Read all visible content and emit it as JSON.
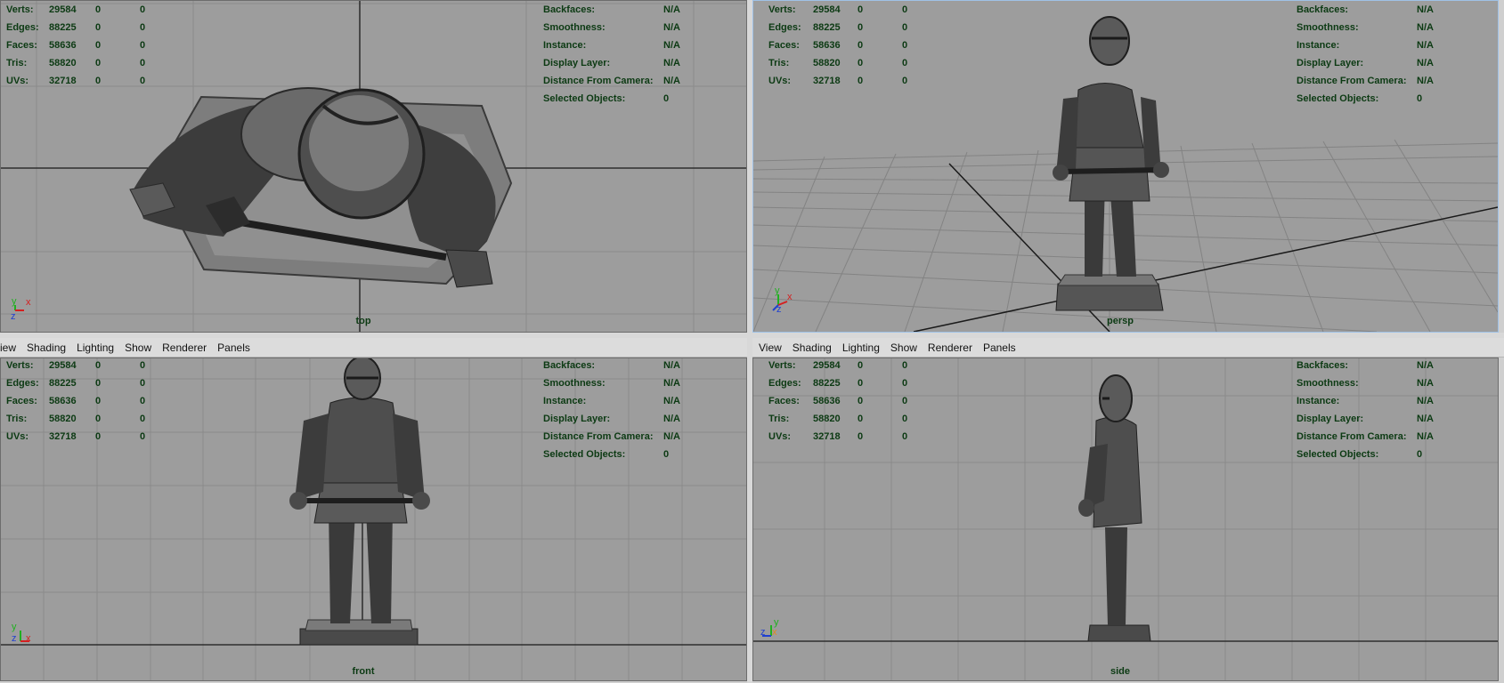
{
  "menu": [
    "View",
    "Shading",
    "Lighting",
    "Show",
    "Renderer",
    "Panels"
  ],
  "menu_left_first": "iew",
  "hud_left": [
    {
      "label": "Verts:",
      "a": "29584",
      "b": "0",
      "c": "0"
    },
    {
      "label": "Edges:",
      "a": "88225",
      "b": "0",
      "c": "0"
    },
    {
      "label": "Faces:",
      "a": "58636",
      "b": "0",
      "c": "0"
    },
    {
      "label": "Tris:",
      "a": "58820",
      "b": "0",
      "c": "0"
    },
    {
      "label": "UVs:",
      "a": "32718",
      "b": "0",
      "c": "0"
    }
  ],
  "hud_right": [
    {
      "label": "Backfaces:",
      "value": "N/A"
    },
    {
      "label": "Smoothness:",
      "value": "N/A"
    },
    {
      "label": "Instance:",
      "value": "N/A"
    },
    {
      "label": "Display Layer:",
      "value": "N/A"
    },
    {
      "label": "Distance From Camera:",
      "value": "N/A"
    },
    {
      "label": "Selected Objects:",
      "value": "0"
    }
  ],
  "viewports": {
    "top": {
      "camera": "top"
    },
    "persp": {
      "camera": "persp"
    },
    "front": {
      "camera": "front"
    },
    "side": {
      "camera": "side"
    }
  },
  "axis": {
    "x": "x",
    "y": "y",
    "z": "z"
  },
  "colors": {
    "viewport_bg": "#9d9d9d",
    "hud_text": "#0c3a13",
    "grid": "#8a8a8a",
    "axis_x": "#d42020",
    "axis_y": "#20b020",
    "axis_z": "#2040d0"
  }
}
